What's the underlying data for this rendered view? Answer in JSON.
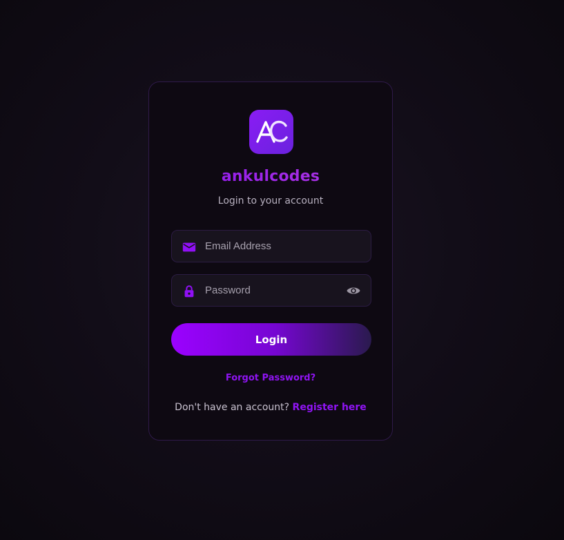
{
  "brand": {
    "logo_text": "AC",
    "name": "ankulcodes",
    "subtitle": "Login to your account"
  },
  "form": {
    "email": {
      "placeholder": "Email Address",
      "value": "",
      "icon": "envelope-icon"
    },
    "password": {
      "placeholder": "Password",
      "value": "",
      "icon": "lock-icon",
      "toggle_icon": "eye-icon"
    },
    "login_label": "Login",
    "forgot_label": "Forgot Password?",
    "register_prompt": "Don't have an account?",
    "register_label": "Register here"
  },
  "colors": {
    "accent": "#8f14f2",
    "background": "#0e0912"
  }
}
